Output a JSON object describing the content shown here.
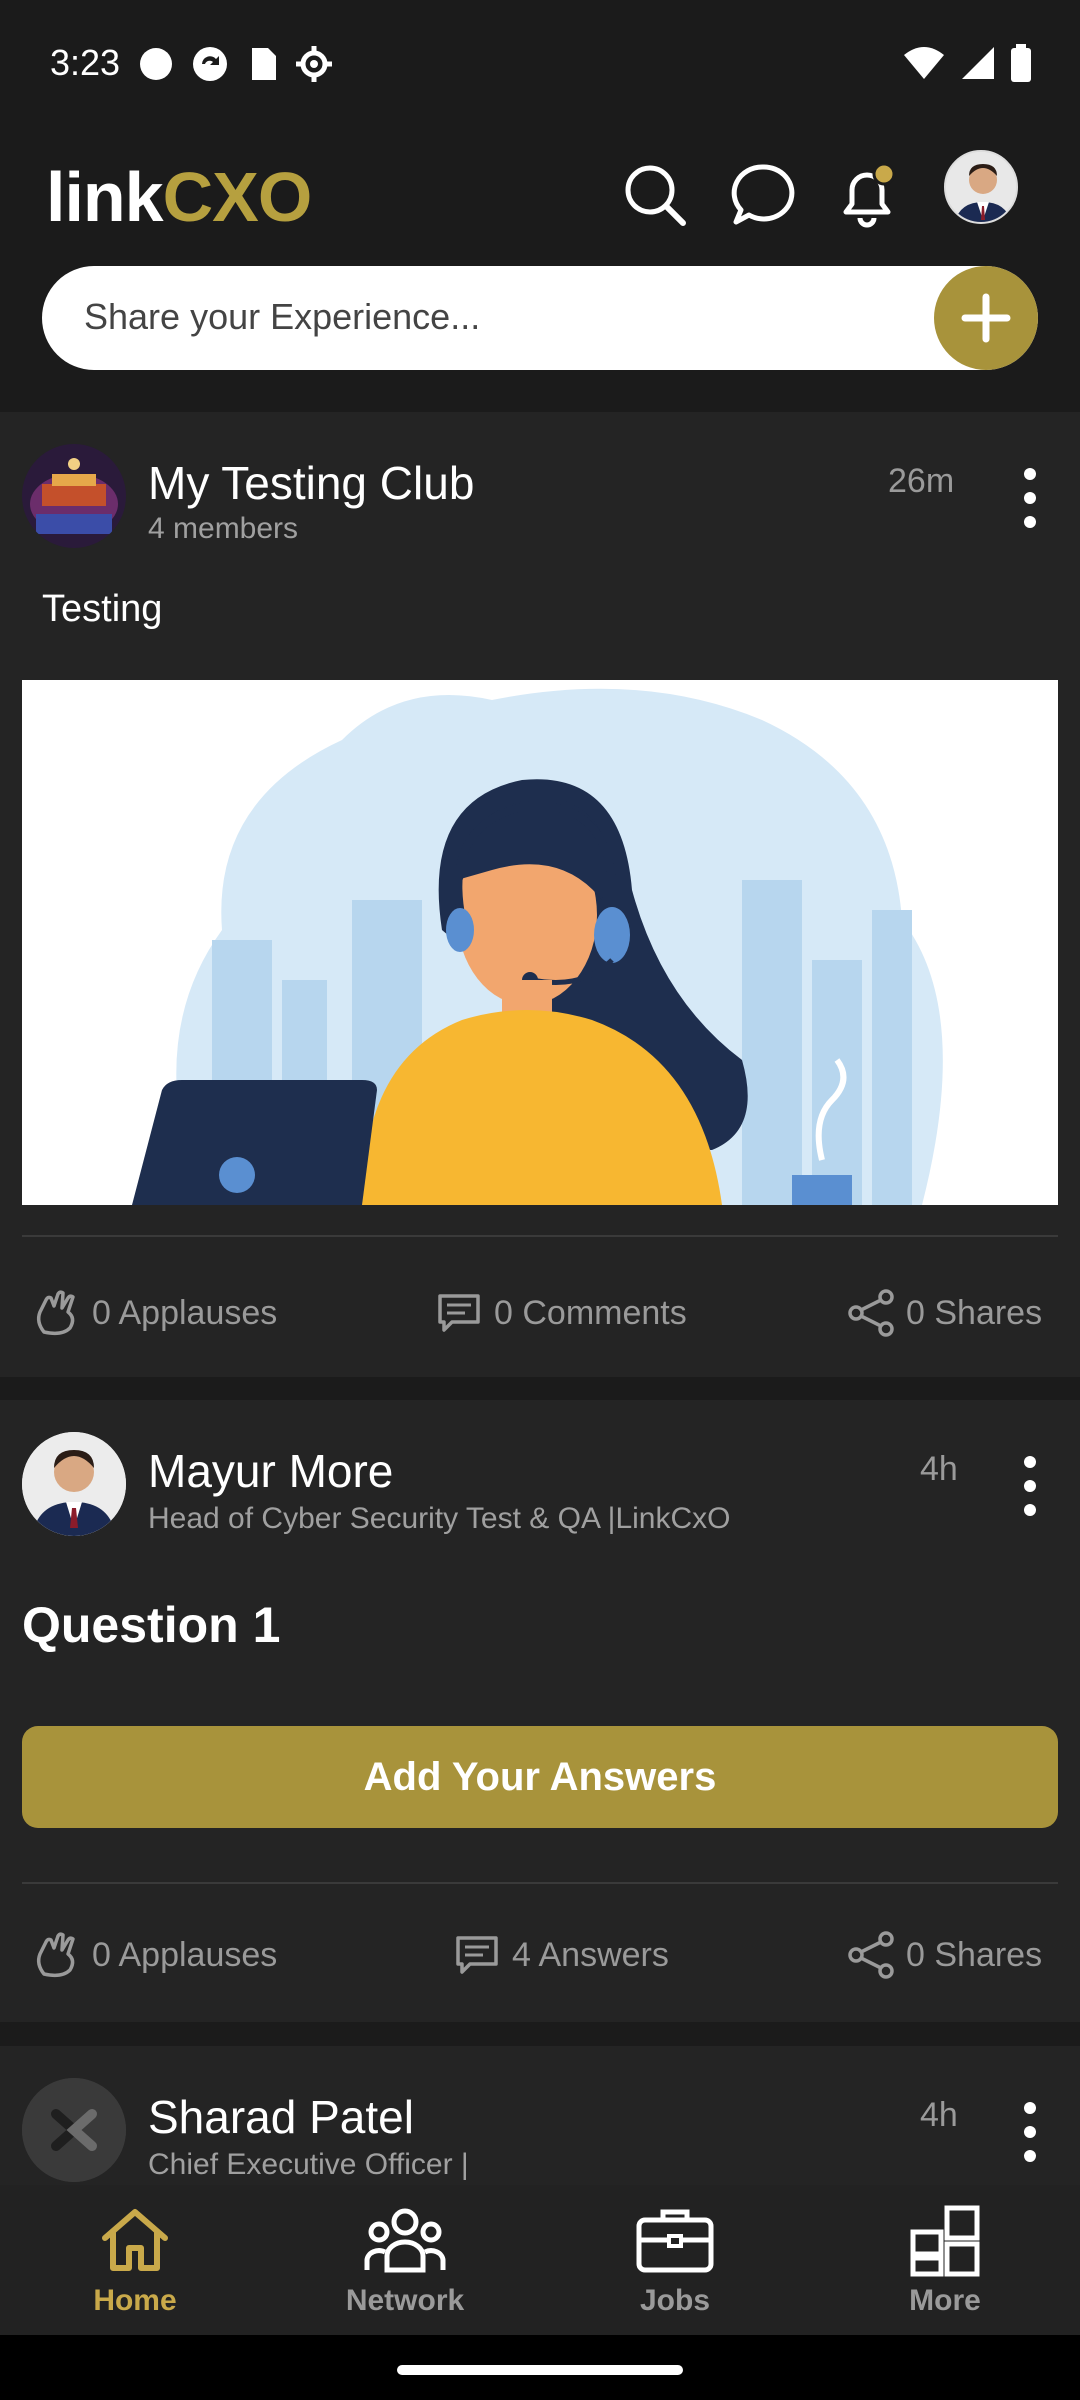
{
  "status": {
    "time": "3:23"
  },
  "header": {
    "logo_part1": "link",
    "logo_part2": "CXO",
    "share_placeholder": "Share your Experience..."
  },
  "posts": [
    {
      "author": "My Testing Club",
      "subtitle": "4 members",
      "time": "26m",
      "text": "Testing",
      "applauses": "0 Applauses",
      "comments": "0 Comments",
      "shares": "0 Shares"
    },
    {
      "author": "Mayur More",
      "subtitle": "Head of Cyber Security Test & QA |LinkCxO",
      "time": "4h",
      "question": "Question 1",
      "cta": "Add Your Answers",
      "applauses": "0 Applauses",
      "answers": "4 Answers",
      "shares": "0 Shares"
    },
    {
      "author": "Sharad Patel",
      "subtitle": "Chief Executive Officer |",
      "time": "4h"
    }
  ],
  "nav": {
    "items": [
      {
        "label": "Home",
        "icon": "home-icon",
        "active": true
      },
      {
        "label": "Network",
        "icon": "network-icon",
        "active": false
      },
      {
        "label": "Jobs",
        "icon": "briefcase-icon",
        "active": false
      },
      {
        "label": "More",
        "icon": "grid-icon",
        "active": false
      }
    ]
  },
  "colors": {
    "accent": "#a8933b",
    "active_nav": "#c9a94a",
    "background": "#1b1b1b",
    "card": "#242424"
  }
}
